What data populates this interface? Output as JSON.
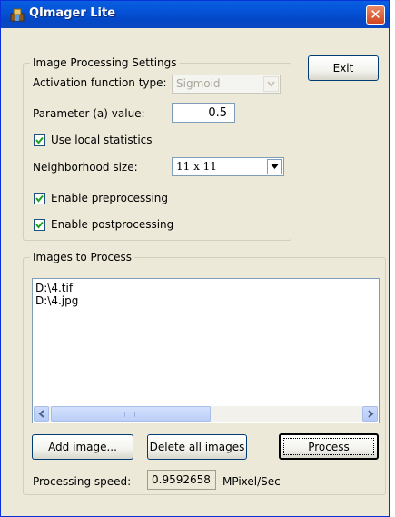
{
  "window": {
    "title": "QImager Lite",
    "close_label": "✕"
  },
  "settings": {
    "group_title": "Image Processing Settings",
    "activation_label": "Activation function type:",
    "activation_value": "Sigmoid",
    "parameter_label": "Parameter (a) value:",
    "parameter_value": "0.5",
    "use_local_stats_label": "Use local statistics",
    "use_local_stats_checked": true,
    "neighborhood_label": "Neighborhood size:",
    "neighborhood_value": "11 x 11",
    "enable_pre_label": "Enable preprocessing",
    "enable_pre_checked": true,
    "enable_post_label": "Enable postprocessing",
    "enable_post_checked": true
  },
  "exit_label": "Exit",
  "images": {
    "group_title": "Images to Process",
    "files": [
      "D:\\4.tif",
      "D:\\4.jpg"
    ]
  },
  "buttons": {
    "add_label": "Add image...",
    "delete_label": "Delete all images",
    "process_label": "Process"
  },
  "speed": {
    "label": "Processing speed:",
    "value": "0.9592658",
    "unit": "MPixel/Sec"
  },
  "colors": {
    "title_bar": "#0452d6",
    "dialog_bg": "#ece9d8",
    "close_button": "#d2451e"
  }
}
